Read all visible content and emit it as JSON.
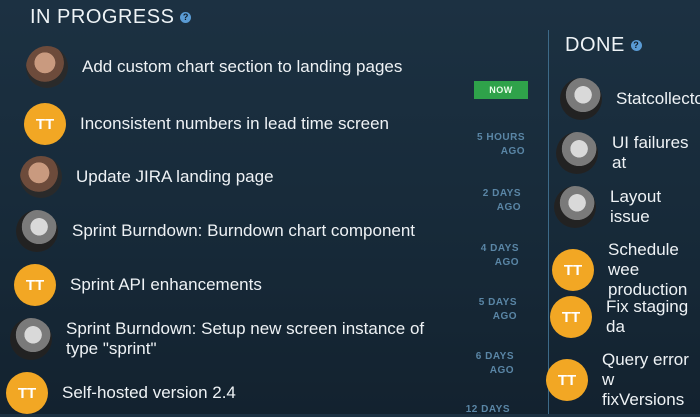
{
  "in_progress": {
    "title": "IN PROGRESS",
    "badge_now": "NOW",
    "items": [
      {
        "task": "Add custom chart section to landing pages",
        "avatar": "photo",
        "time_line1": "",
        "time_line2": ""
      },
      {
        "task": "Inconsistent numbers in lead time screen",
        "avatar": "TT",
        "time_line1": "5 HOURS",
        "time_line2": "AGO"
      },
      {
        "task": "Update JIRA landing page",
        "avatar": "photo",
        "time_line1": "2 DAYS",
        "time_line2": "AGO"
      },
      {
        "task": "Sprint Burndown: Burndown chart component",
        "avatar": "photo",
        "time_line1": "4 DAYS",
        "time_line2": "AGO"
      },
      {
        "task": "Sprint API enhancements",
        "avatar": "TT",
        "time_line1": "5 DAYS",
        "time_line2": "AGO"
      },
      {
        "task_line1": "Sprint Burndown: Setup new screen instance of",
        "task_line2": "type \"sprint\"",
        "avatar": "photo",
        "time_line1": "6 DAYS",
        "time_line2": "AGO"
      },
      {
        "task": "Self-hosted version 2.4",
        "avatar": "TT",
        "time_line1": "12 DAYS",
        "time_line2": ""
      }
    ]
  },
  "done": {
    "title": "DONE",
    "items": [
      {
        "task": "Statcollecto",
        "avatar": "photo"
      },
      {
        "task": "UI failures at",
        "avatar": "photo"
      },
      {
        "task": "Layout issue",
        "avatar": "photo"
      },
      {
        "task_line1": "Schedule wee",
        "task_line2": "production",
        "avatar": "TT"
      },
      {
        "task": "Fix staging da",
        "avatar": "TT"
      },
      {
        "task_line1": "Query error w",
        "task_line2": "fixVersions",
        "avatar": "TT"
      }
    ]
  },
  "avatar_initials": "TT",
  "colors": {
    "accent_badge": "#2fa24a",
    "avatar_tt": "#f2a724",
    "background": "#1c3142"
  }
}
